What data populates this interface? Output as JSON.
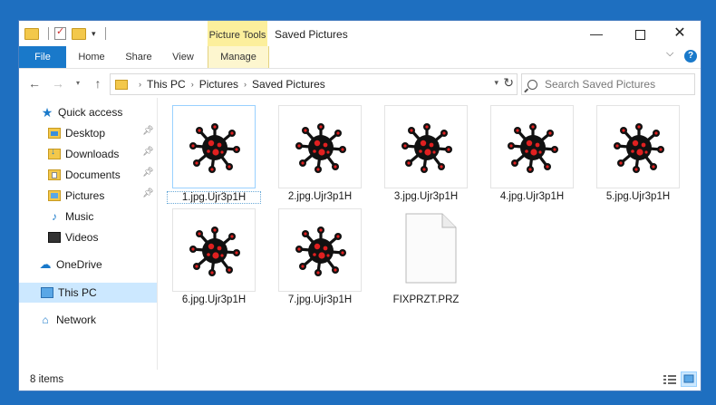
{
  "window": {
    "title": "Saved Pictures",
    "context_tab_group": "Picture Tools"
  },
  "ribbon": {
    "tabs": [
      "File",
      "Home",
      "Share",
      "View",
      "Manage"
    ]
  },
  "address": {
    "segments": [
      "This PC",
      "Pictures",
      "Saved Pictures"
    ],
    "search_placeholder": "Search Saved Pictures"
  },
  "nav": {
    "quick_access": "Quick access",
    "items": [
      {
        "label": "Desktop",
        "pinned": true
      },
      {
        "label": "Downloads",
        "pinned": true
      },
      {
        "label": "Documents",
        "pinned": true
      },
      {
        "label": "Pictures",
        "pinned": true
      },
      {
        "label": "Music",
        "pinned": false
      },
      {
        "label": "Videos",
        "pinned": false
      }
    ],
    "onedrive": "OneDrive",
    "this_pc": "This PC",
    "network": "Network"
  },
  "files": [
    {
      "name": "1.jpg.Ujr3p1H",
      "kind": "encrypted-image",
      "selected": true
    },
    {
      "name": "2.jpg.Ujr3p1H",
      "kind": "encrypted-image",
      "selected": false
    },
    {
      "name": "3.jpg.Ujr3p1H",
      "kind": "encrypted-image",
      "selected": false
    },
    {
      "name": "4.jpg.Ujr3p1H",
      "kind": "encrypted-image",
      "selected": false
    },
    {
      "name": "5.jpg.Ujr3p1H",
      "kind": "encrypted-image",
      "selected": false
    },
    {
      "name": "6.jpg.Ujr3p1H",
      "kind": "encrypted-image",
      "selected": false
    },
    {
      "name": "7.jpg.Ujr3p1H",
      "kind": "encrypted-image",
      "selected": false
    },
    {
      "name": "FIXPRZT.PRZ",
      "kind": "document",
      "selected": false
    }
  ],
  "status": {
    "item_count": "8 items"
  },
  "colors": {
    "accent": "#1979ca",
    "context_tab": "#fcef9c",
    "virus_body": "#111111",
    "virus_dots": "#e02020"
  }
}
